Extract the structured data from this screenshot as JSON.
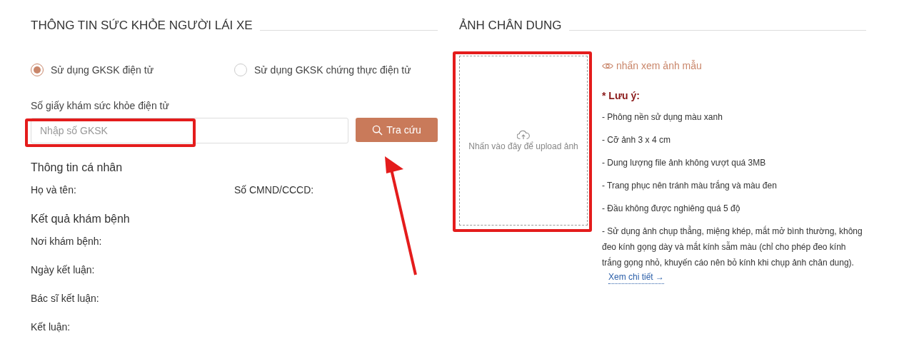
{
  "health_section": {
    "title": "THÔNG TIN SỨC KHỎE NGƯỜI LÁI XE",
    "options": [
      {
        "label": "Sử dụng GKSK điện tử",
        "selected": true
      },
      {
        "label": "Sử dụng GKSK chứng thực điện tử",
        "selected": false
      }
    ],
    "lookup": {
      "label": "Số giấy khám sức khỏe điện tử",
      "placeholder": "Nhập số GKSK",
      "button": "Tra cứu"
    },
    "personal": {
      "title": "Thông tin cá nhân",
      "fields": [
        "Họ và tên:",
        "Số CMND/CCCD:"
      ]
    },
    "results": {
      "title": "Kết quả khám bệnh",
      "fields": [
        "Nơi khám bệnh:",
        "Ngày kết luận:",
        "Bác sĩ kết luận:",
        "Kết luận:"
      ]
    }
  },
  "portrait_section": {
    "title": "ẢNH CHÂN DUNG",
    "upload_hint": "Nhấn vào đây để upload ảnh",
    "sample_link": "nhấn xem ảnh mẫu",
    "notes_title": "* Lưu ý:",
    "notes": [
      "- Phông nền sử dụng màu xanh",
      "- Cỡ ảnh 3 x 4 cm",
      "- Dung lượng file ảnh không vượt quá 3MB",
      "- Trang phục nên tránh màu trắng và màu đen",
      "- Đầu không được nghiêng quá 5 độ",
      "- Sử dụng ảnh chụp thẳng, miệng khép, mắt mở bình thường, không đeo kính gọng dày và mắt kính sẫm màu (chỉ cho phép đeo kính trắng gọng nhỏ, khuyến cáo nên bỏ kính khi chụp ảnh chân dung)."
    ],
    "details_link": "Xem chi tiết →"
  }
}
